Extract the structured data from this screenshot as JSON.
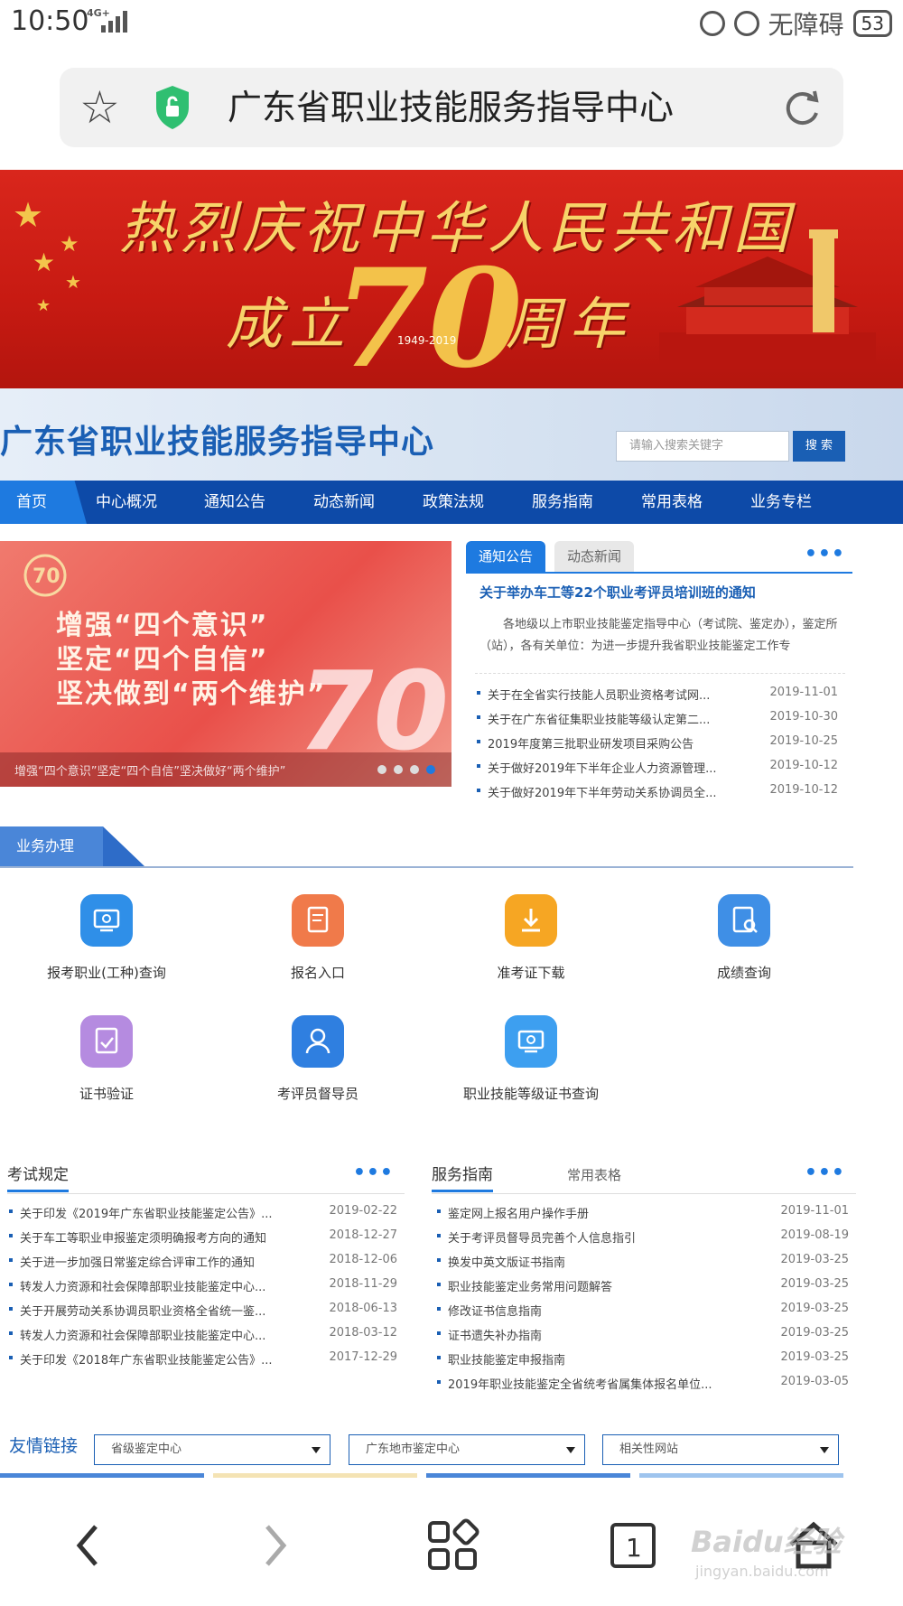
{
  "status_bar": {
    "time": "10:50",
    "network": "4G+",
    "accessibility": "无障碍",
    "battery": "53"
  },
  "address_bar": {
    "url_title": "广东省职业技能服务指导中心"
  },
  "banner": {
    "line1": "热烈庆祝中华人民共和国",
    "line2_left": "成立",
    "line2_right": "周年",
    "number": "70",
    "years": "1949-2019"
  },
  "site": {
    "title": "广东省职业技能服务指导中心",
    "search_placeholder": "请输入搜索关键字",
    "search_button": "搜 索"
  },
  "nav": {
    "items": [
      "首页",
      "中心概况",
      "通知公告",
      "动态新闻",
      "政策法规",
      "服务指南",
      "常用表格",
      "业务专栏"
    ]
  },
  "slider": {
    "lines": [
      "增强“四个意识”",
      "坚定“四个自信”",
      "坚决做到“两个维护”"
    ],
    "caption": "增强“四个意识”坚定“四个自信”坚决做好“两个维护”",
    "dots": 4,
    "active_dot": 4
  },
  "notices": {
    "tabs": [
      "通知公告",
      "动态新闻"
    ],
    "more": "•••",
    "headline": "关于举办车工等22个职业考评员培训班的通知",
    "summary": "各地级以上市职业技能鉴定指导中心（考试院、鉴定办），鉴定所（站），各有关单位：为进一步提升我省职业技能鉴定工作专",
    "items": [
      {
        "title": "关于在全省实行技能人员职业资格考试网...",
        "date": "2019-11-01"
      },
      {
        "title": "关于在广东省征集职业技能等级认定第二...",
        "date": "2019-10-30"
      },
      {
        "title": "2019年度第三批职业研发项目采购公告",
        "date": "2019-10-25"
      },
      {
        "title": "关于做好2019年下半年企业人力资源管理...",
        "date": "2019-10-12"
      },
      {
        "title": "关于做好2019年下半年劳动关系协调员全...",
        "date": "2019-10-12"
      }
    ]
  },
  "business": {
    "title": "业务办理",
    "items": [
      {
        "label": "报考职业(工种)查询",
        "icon": "screen-search-icon",
        "color": "#2f8fe8"
      },
      {
        "label": "报名入口",
        "icon": "document-edit-icon",
        "color": "#f07a4a"
      },
      {
        "label": "准考证下载",
        "icon": "download-icon",
        "color": "#f6a623"
      },
      {
        "label": "成绩查询",
        "icon": "document-search-icon",
        "color": "#3f8fe6"
      },
      {
        "label": "证书验证",
        "icon": "certificate-check-icon",
        "color": "#b58be0"
      },
      {
        "label": "考评员督导员",
        "icon": "user-icon",
        "color": "#2f7fe0"
      },
      {
        "label": "职业技能等级证书查询",
        "icon": "screen-search-icon",
        "color": "#3d9ff0"
      }
    ]
  },
  "exam_rules": {
    "title": "考试规定",
    "more": "•••",
    "items": [
      {
        "title": "关于印发《2019年广东省职业技能鉴定公告》...",
        "date": "2019-02-22"
      },
      {
        "title": "关于车工等职业申报鉴定须明确报考方向的通知",
        "date": "2018-12-27"
      },
      {
        "title": "关于进一步加强日常鉴定综合评审工作的通知",
        "date": "2018-12-06"
      },
      {
        "title": "转发人力资源和社会保障部职业技能鉴定中心...",
        "date": "2018-11-29"
      },
      {
        "title": "关于开展劳动关系协调员职业资格全省统一鉴...",
        "date": "2018-06-13"
      },
      {
        "title": "转发人力资源和社会保障部职业技能鉴定中心...",
        "date": "2018-03-12"
      },
      {
        "title": "关于印发《2018年广东省职业技能鉴定公告》...",
        "date": "2017-12-29"
      }
    ]
  },
  "service_guide": {
    "tabs": [
      "服务指南",
      "常用表格"
    ],
    "more": "•••",
    "items": [
      {
        "title": "鉴定网上报名用户操作手册",
        "date": "2019-11-01"
      },
      {
        "title": "关于考评员督导员完善个人信息指引",
        "date": "2019-08-19"
      },
      {
        "title": "换发中英文版证书指南",
        "date": "2019-03-25"
      },
      {
        "title": "职业技能鉴定业务常用问题解答",
        "date": "2019-03-25"
      },
      {
        "title": "修改证书信息指南",
        "date": "2019-03-25"
      },
      {
        "title": "证书遗失补办指南",
        "date": "2019-03-25"
      },
      {
        "title": "职业技能鉴定申报指南",
        "date": "2019-03-25"
      },
      {
        "title": "2019年职业技能鉴定全省统考省属集体报名单位...",
        "date": "2019-03-05"
      }
    ]
  },
  "friend_links": {
    "title": "友情链接",
    "dropdowns": [
      "省级鉴定中心",
      "广东地市鉴定中心",
      "相关性网站"
    ]
  },
  "watermark": {
    "line1": "Baidu经验",
    "line2": "jingyan.baidu.com"
  }
}
